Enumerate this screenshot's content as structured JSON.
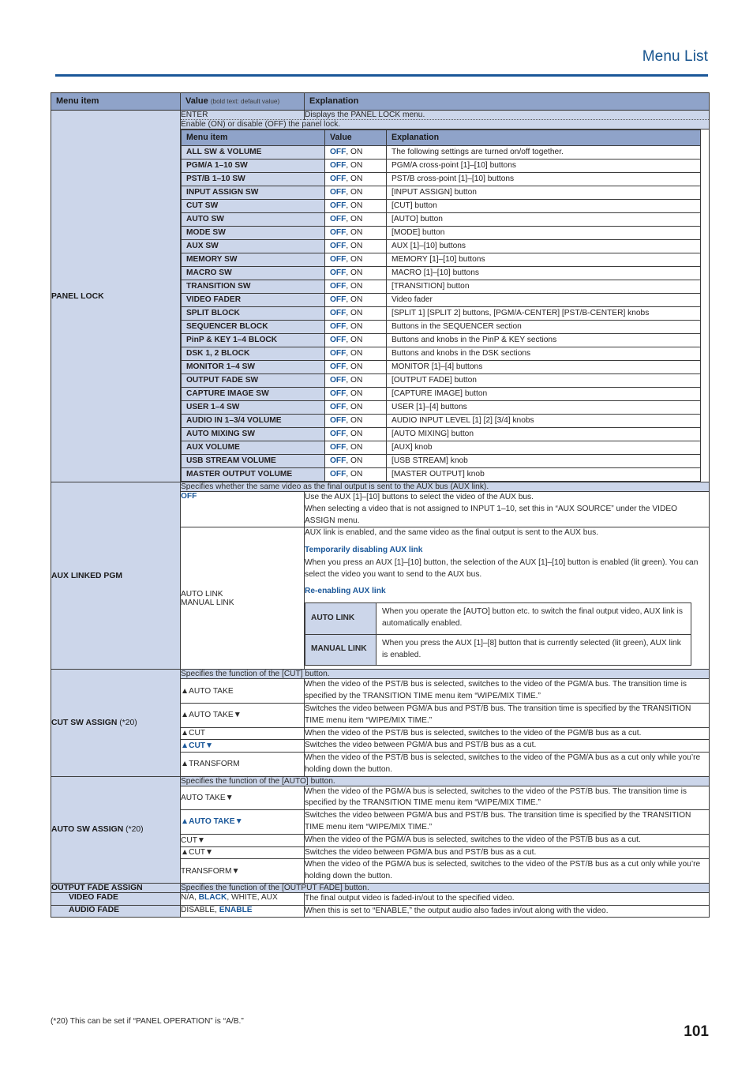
{
  "header": {
    "running_title": "Menu List"
  },
  "table": {
    "columns": {
      "menu_item": "Menu item",
      "value": "Value",
      "value_note": "(bold text: default value)",
      "explanation": "Explanation"
    }
  },
  "panel_lock": {
    "label": "PANEL LOCK",
    "enter_value": "ENTER",
    "enter_explanation": "Displays the PANEL LOCK menu.",
    "span_note": "Enable (ON) or disable (OFF) the panel lock.",
    "nested_headers": {
      "menu_item": "Menu item",
      "value": "Value",
      "explanation": "Explanation"
    },
    "rows": [
      {
        "item": "ALL SW & VOLUME",
        "default": "OFF",
        "other": ", ON",
        "explanation": "The following settings are turned on/off together."
      },
      {
        "item": "PGM/A 1–10 SW",
        "default": "OFF",
        "other": ", ON",
        "explanation": "PGM/A cross-point [1]–[10] buttons"
      },
      {
        "item": "PST/B 1–10 SW",
        "default": "OFF",
        "other": ", ON",
        "explanation": "PST/B cross-point [1]–[10] buttons"
      },
      {
        "item": "INPUT ASSIGN SW",
        "default": "OFF",
        "other": ", ON",
        "explanation": "[INPUT ASSIGN] button"
      },
      {
        "item": "CUT SW",
        "default": "OFF",
        "other": ", ON",
        "explanation": "[CUT] button"
      },
      {
        "item": "AUTO SW",
        "default": "OFF",
        "other": ", ON",
        "explanation": "[AUTO] button"
      },
      {
        "item": "MODE SW",
        "default": "OFF",
        "other": ", ON",
        "explanation": "[MODE] button"
      },
      {
        "item": "AUX SW",
        "default": "OFF",
        "other": ", ON",
        "explanation": "AUX [1]–[10] buttons"
      },
      {
        "item": "MEMORY SW",
        "default": "OFF",
        "other": ", ON",
        "explanation": "MEMORY [1]–[10] buttons"
      },
      {
        "item": "MACRO SW",
        "default": "OFF",
        "other": ", ON",
        "explanation": "MACRO [1]–[10] buttons"
      },
      {
        "item": "TRANSITION SW",
        "default": "OFF",
        "other": ", ON",
        "explanation": "[TRANSITION] button"
      },
      {
        "item": "VIDEO FADER",
        "default": "OFF",
        "other": ", ON",
        "explanation": "Video fader"
      },
      {
        "item": "SPLIT BLOCK",
        "default": "OFF",
        "other": ", ON",
        "explanation": "[SPLIT 1] [SPLIT 2] buttons, [PGM/A-CENTER] [PST/B-CENTER] knobs"
      },
      {
        "item": "SEQUENCER BLOCK",
        "default": "OFF",
        "other": ", ON",
        "explanation": "Buttons in the SEQUENCER section"
      },
      {
        "item": "PinP & KEY 1–4 BLOCK",
        "default": "OFF",
        "other": ", ON",
        "explanation": "Buttons and knobs in the PinP & KEY sections"
      },
      {
        "item": "DSK 1, 2 BLOCK",
        "default": "OFF",
        "other": ", ON",
        "explanation": "Buttons and knobs in the DSK sections"
      },
      {
        "item": "MONITOR 1–4 SW",
        "default": "OFF",
        "other": ", ON",
        "explanation": "MONITOR [1]–[4] buttons"
      },
      {
        "item": "OUTPUT FADE SW",
        "default": "OFF",
        "other": ", ON",
        "explanation": "[OUTPUT FADE] button"
      },
      {
        "item": "CAPTURE IMAGE SW",
        "default": "OFF",
        "other": ", ON",
        "explanation": "[CAPTURE IMAGE] button"
      },
      {
        "item": "USER 1–4 SW",
        "default": "OFF",
        "other": ", ON",
        "explanation": "USER [1]–[4] buttons"
      },
      {
        "item": "AUDIO IN 1–3/4 VOLUME",
        "default": "OFF",
        "other": ", ON",
        "explanation": "AUDIO INPUT LEVEL [1] [2] [3/4] knobs"
      },
      {
        "item": "AUTO MIXING SW",
        "default": "OFF",
        "other": ", ON",
        "explanation": "[AUTO MIXING] button"
      },
      {
        "item": "AUX VOLUME",
        "default": "OFF",
        "other": ", ON",
        "explanation": "[AUX] knob"
      },
      {
        "item": "USB STREAM VOLUME",
        "default": "OFF",
        "other": ", ON",
        "explanation": "[USB STREAM] knob"
      },
      {
        "item": "MASTER OUTPUT VOLUME",
        "default": "OFF",
        "other": ", ON",
        "explanation": "[MASTER OUTPUT] knob"
      }
    ]
  },
  "aux_linked_pgm": {
    "label": "AUX LINKED PGM",
    "span_note": "Specifies whether the same video as the final output is sent to the AUX bus (AUX link).",
    "off": {
      "value": "OFF",
      "line1": "Use the AUX [1]–[10] buttons to select the video of the AUX bus.",
      "line2": "When selecting a video that is not assigned to INPUT 1–10, set this in “AUX SOURCE” under the VIDEO ASSIGN menu."
    },
    "link": {
      "value_line1": "AUTO LINK",
      "value_line2": "MANUAL LINK",
      "intro": "AUX link is enabled, and the same video as the final output is sent to the AUX bus.",
      "sub1_title": "Temporarily disabling AUX link",
      "sub1_body": "When you press an AUX [1]–[10] button, the selection of the AUX [1]–[10] button is enabled (lit green). You can select the video you want to send to the AUX bus.",
      "sub2_title": "Re-enabling AUX link",
      "table": [
        {
          "name": "AUTO LINK",
          "desc": "When you operate the [AUTO] button etc. to switch the final output video, AUX link is automatically enabled."
        },
        {
          "name": "MANUAL LINK",
          "desc": "When you press the AUX [1]–[8] button that is currently selected (lit green), AUX link is enabled."
        }
      ]
    }
  },
  "cut_sw_assign": {
    "label": "CUT SW ASSIGN",
    "footnote_ref": " (*20)",
    "span_note": "Specifies the function of the [CUT] button.",
    "rows": [
      {
        "value": "▲AUTO TAKE",
        "is_default": false,
        "explanation": "When the video of the PST/B bus is selected, switches to the video of the PGM/A bus. The transition time is specified by the TRANSITION TIME menu item “WIPE/MIX TIME.”"
      },
      {
        "value": "▲AUTO TAKE▼",
        "is_default": false,
        "explanation": "Switches the video between PGM/A bus and PST/B bus. The transition time is specified by the TRANSITION TIME menu item “WIPE/MIX TIME.”"
      },
      {
        "value": "▲CUT",
        "is_default": false,
        "explanation": "When the video of the PST/B bus is selected, switches to the video of the PGM/B bus as a cut."
      },
      {
        "value": "▲CUT▼",
        "is_default": true,
        "explanation": "Switches the video between PGM/A bus and PST/B bus as a cut."
      },
      {
        "value": "▲TRANSFORM",
        "is_default": false,
        "explanation": "When the video of the PST/B bus is selected, switches to the video of the PGM/A bus as a cut only while you’re holding down the button."
      }
    ]
  },
  "auto_sw_assign": {
    "label": "AUTO SW ASSIGN",
    "footnote_ref": " (*20)",
    "span_note": "Specifies the function of the [AUTO] button.",
    "rows": [
      {
        "value": "AUTO TAKE▼",
        "is_default": false,
        "explanation": "When the video of the PGM/A bus is selected, switches to the video of the PST/B bus. The transition time is specified by the TRANSITION TIME menu item “WIPE/MIX TIME.”"
      },
      {
        "value": "▲AUTO TAKE▼",
        "is_default": true,
        "explanation": "Switches the video between PGM/A bus and PST/B bus. The transition time is specified by the TRANSITION TIME menu item “WIPE/MIX TIME.”"
      },
      {
        "value": "CUT▼",
        "is_default": false,
        "explanation": "When the video of the PGM/A bus is selected, switches to the video of the PST/B bus as a cut."
      },
      {
        "value": "▲CUT▼",
        "is_default": false,
        "explanation": "Switches the video between PGM/A bus and PST/B bus as a cut."
      },
      {
        "value": "TRANSFORM▼",
        "is_default": false,
        "explanation": "When the video of the PGM/A bus is selected, switches to the video of the PST/B bus as a cut only while you’re holding down the button."
      }
    ]
  },
  "output_fade_assign": {
    "label": "OUTPUT FADE ASSIGN",
    "span_note": "Specifies the function of the [OUTPUT FADE] button.",
    "video_fade": {
      "label": "VIDEO FADE",
      "value_pre": "N/A, ",
      "value_default": "BLACK",
      "value_post": ", WHITE, AUX",
      "explanation": "The final output video is faded-in/out to the specified video."
    },
    "audio_fade": {
      "label": "AUDIO FADE",
      "value_pre": "DISABLE, ",
      "value_default": "ENABLE",
      "value_post": "",
      "explanation": "When this is set to “ENABLE,” the output audio also fades in/out along with the video."
    }
  },
  "footnote": "(*20) This can be set if “PANEL OPERATION” is “A/B.”",
  "page_number": "101",
  "colors": {
    "accent_blue": "#1a5799",
    "header_band": "#8fa3c9",
    "row_tint": "#ccd6ea",
    "rule": "#1a5799"
  }
}
